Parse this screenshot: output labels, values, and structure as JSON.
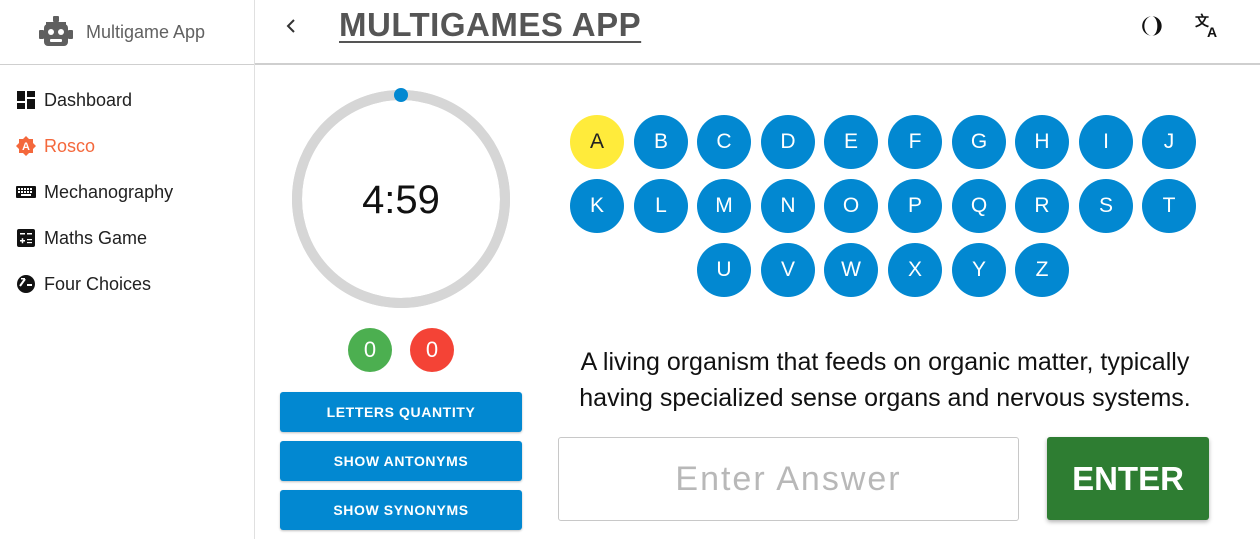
{
  "brand": {
    "name": "Multigame App"
  },
  "header": {
    "title": "MULTIGAMES APP",
    "icons": [
      "back-chevron-icon",
      "dark-mode-icon",
      "translate-icon"
    ]
  },
  "sidebar": {
    "items": [
      {
        "label": "Dashboard",
        "icon": "dashboard-icon",
        "active": false
      },
      {
        "label": "Rosco",
        "icon": "rosco-icon",
        "active": true
      },
      {
        "label": "Mechanography",
        "icon": "keyboard-icon",
        "active": false
      },
      {
        "label": "Maths Game",
        "icon": "calculator-icon",
        "active": false
      },
      {
        "label": "Four Choices",
        "icon": "choices-icon",
        "active": false
      }
    ]
  },
  "game": {
    "timer": "4:59",
    "timer_progress": 1.0,
    "correct": "0",
    "wrong": "0",
    "buttons": {
      "letters_quantity": "LETTERS QUANTITY",
      "show_antonyms": "SHOW ANTONYMS",
      "show_synonyms": "SHOW SYNONYMS"
    },
    "letters": [
      "A",
      "B",
      "C",
      "D",
      "E",
      "F",
      "G",
      "H",
      "I",
      "J",
      "K",
      "L",
      "M",
      "N",
      "O",
      "P",
      "Q",
      "R",
      "S",
      "T",
      "U",
      "V",
      "W",
      "X",
      "Y",
      "Z"
    ],
    "current_letter": "A",
    "definition": "A living organism that feeds on organic matter, typically having specialized sense organs and nervous systems.",
    "answer_placeholder": "Enter Answer",
    "answer_value": "",
    "enter_label": "ENTER"
  },
  "colors": {
    "accent_blue": "#0288d1",
    "active_nav": "#f4683c",
    "current_letter": "#ffeb3b",
    "correct": "#4caf50",
    "wrong": "#f44336",
    "enter_button": "#2e7d32",
    "timer_track": "#d6d6d6"
  }
}
